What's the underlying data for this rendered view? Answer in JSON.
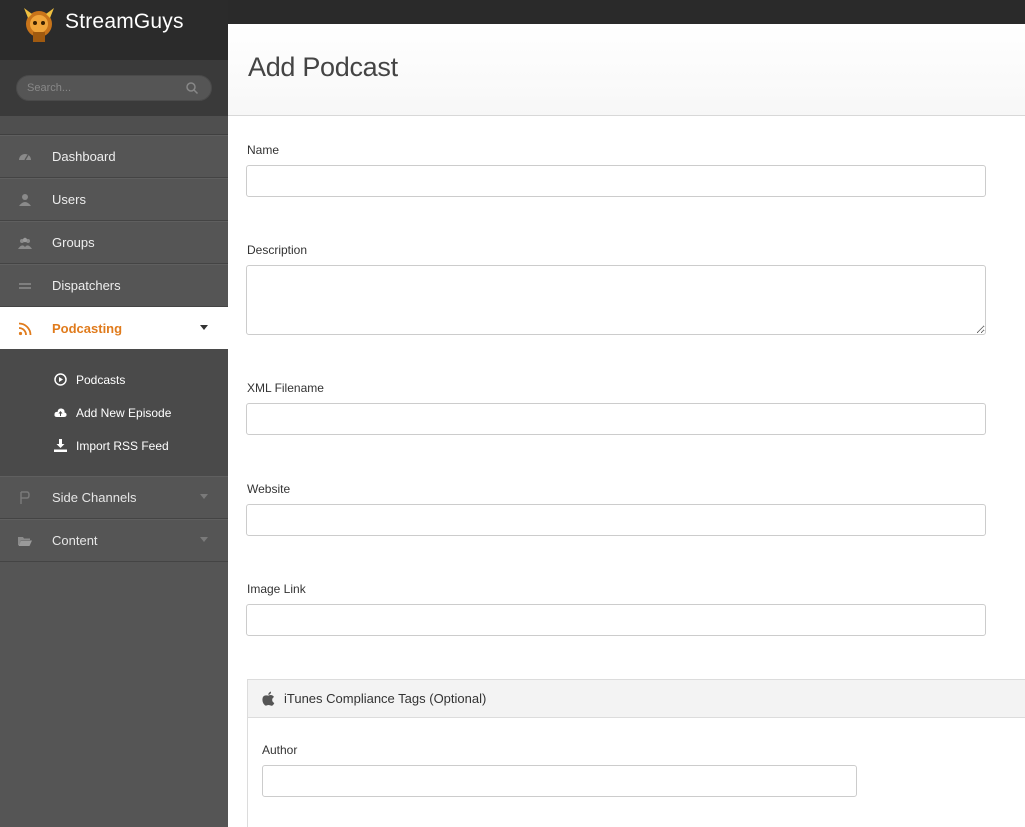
{
  "brand": {
    "name": "StreamGuys"
  },
  "search": {
    "placeholder": "Search..."
  },
  "sidebar": {
    "items": [
      {
        "label": "Dashboard"
      },
      {
        "label": "Users"
      },
      {
        "label": "Groups"
      },
      {
        "label": "Dispatchers"
      },
      {
        "label": "Podcasting"
      },
      {
        "label": "Side Channels"
      },
      {
        "label": "Content"
      }
    ],
    "submenu": [
      {
        "label": "Podcasts"
      },
      {
        "label": "Add New Episode"
      },
      {
        "label": "Import RSS Feed"
      }
    ],
    "active": "Podcasting"
  },
  "page": {
    "title": "Add Podcast"
  },
  "form": {
    "name_label": "Name",
    "name_value": "",
    "description_label": "Description",
    "description_value": "",
    "xml_label": "XML Filename",
    "xml_value": "",
    "website_label": "Website",
    "website_value": "",
    "image_label": "Image Link",
    "image_value": ""
  },
  "itunes": {
    "title": "iTunes Compliance Tags (Optional)",
    "author_label": "Author",
    "author_value": ""
  },
  "colors": {
    "accent": "#e07b1c",
    "sidebar_bg": "#555555",
    "brand_bg": "#2b2b2b"
  }
}
